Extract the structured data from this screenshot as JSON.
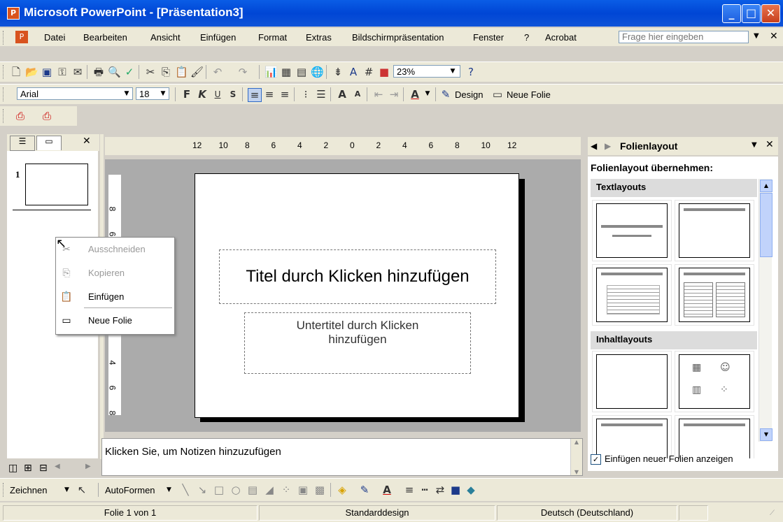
{
  "window": {
    "title": "Microsoft PowerPoint - [Präsentation3]",
    "app_icon": "powerpoint-icon"
  },
  "menu": {
    "items": [
      "Datei",
      "Bearbeiten",
      "Ansicht",
      "Einfügen",
      "Format",
      "Extras",
      "Bildschirmpräsentation",
      "Fenster",
      "?",
      "Acrobat"
    ],
    "help_placeholder": "Frage hier eingeben"
  },
  "standard_toolbar": {
    "zoom": "23%"
  },
  "format_toolbar": {
    "font": "Arial",
    "size": "18",
    "bold": "F",
    "italic": "K",
    "underline": "U",
    "shadow": "S",
    "design_label": "Design",
    "new_slide_label": "Neue Folie"
  },
  "left_pane": {
    "slide_number": "1"
  },
  "ruler": {
    "h_ticks": [
      "12",
      "10",
      "8",
      "6",
      "4",
      "2",
      "0",
      "2",
      "4",
      "6",
      "8",
      "10",
      "12"
    ],
    "v_ticks_top": [
      "8",
      "6"
    ],
    "v_ticks_bottom": [
      "4",
      "6",
      "8"
    ]
  },
  "slide": {
    "title_placeholder": "Titel durch Klicken hinzufügen",
    "subtitle_placeholder": "Untertitel durch Klicken hinzufügen"
  },
  "context_menu": {
    "items": [
      {
        "label": "Ausschneiden",
        "enabled": false,
        "icon": "scissors-icon"
      },
      {
        "label": "Kopieren",
        "enabled": false,
        "icon": "copy-icon"
      },
      {
        "label": "Einfügen",
        "enabled": true,
        "icon": "paste-icon"
      },
      {
        "label": "Neue Folie",
        "enabled": true,
        "icon": "new-slide-icon"
      }
    ]
  },
  "notes": {
    "placeholder": "Klicken Sie, um Notizen hinzuzufügen"
  },
  "task_pane": {
    "title": "Folienlayout",
    "apply_label": "Folienlayout übernehmen:",
    "section_text": "Textlayouts",
    "section_content": "Inhaltlayouts",
    "show_on_insert_label": "Einfügen neuer Folien anzeigen",
    "show_on_insert_checked": true
  },
  "drawing_toolbar": {
    "draw_label": "Zeichnen",
    "autoshapes_label": "AutoFormen"
  },
  "status": {
    "slide": "Folie 1 von 1",
    "design": "Standarddesign",
    "language": "Deutsch (Deutschland)"
  }
}
